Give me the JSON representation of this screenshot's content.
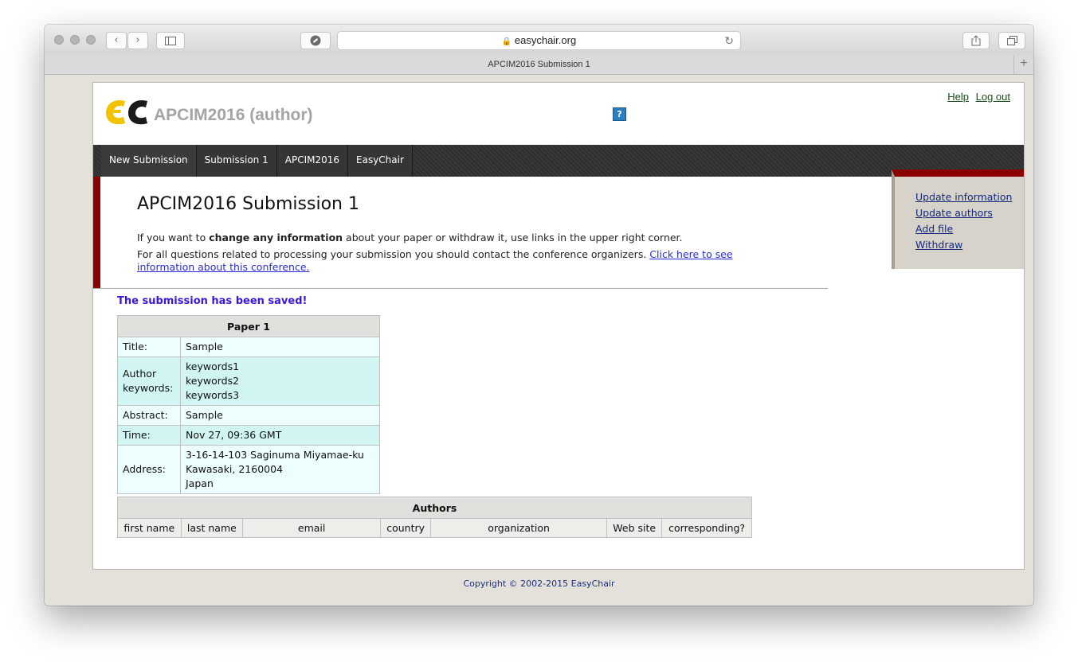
{
  "browser": {
    "address": "easychair.org",
    "tab_title": "APCIM2016 Submission 1",
    "back_glyph": "‹",
    "forward_glyph": "›",
    "newtab_glyph": "+"
  },
  "header": {
    "site_title": "APCIM2016 (author)",
    "help_icon_text": "?",
    "help_link": "Help",
    "logout_link": "Log out"
  },
  "nav": {
    "items": [
      "New Submission",
      "Submission 1",
      "APCIM2016",
      "EasyChair"
    ]
  },
  "main": {
    "heading": "APCIM2016 Submission 1",
    "info1_pre": "If you want to ",
    "info1_bold": "change any information",
    "info1_post": " about your paper or withdraw it, use links in the upper right corner.",
    "info2_text": "For all questions related to processing your submission you should contact the conference organizers. ",
    "info2_link": "Click here to see information about this conference.",
    "saved_message": "The submission has been saved!"
  },
  "sidebar": {
    "links": [
      "Update information",
      "Update authors",
      "Add file",
      "Withdraw"
    ]
  },
  "paper": {
    "header": "Paper 1",
    "rows": [
      {
        "label": "Title:",
        "value": "Sample"
      },
      {
        "label": "Author keywords:",
        "values": [
          "keywords1",
          "keywords2",
          "keywords3"
        ]
      },
      {
        "label": "Abstract:",
        "value": "Sample"
      },
      {
        "label": "Time:",
        "value": "Nov 27, 09:36 GMT"
      },
      {
        "label": "Address:",
        "values": [
          "3-16-14-103 Saginuma Miyamae-ku",
          "Kawasaki, 2160004",
          "Japan"
        ]
      }
    ]
  },
  "authors": {
    "header": "Authors",
    "columns": [
      "first name",
      "last name",
      "email",
      "country",
      "organization",
      "Web site",
      "corresponding?"
    ]
  },
  "footer": {
    "copyright": "Copyright © 2002-2015 EasyChair"
  },
  "colors": {
    "brand_red": "#8b0000",
    "link_blue": "#2b2bdd",
    "saved_purple": "#3a17d8",
    "row_light": "#edfefe",
    "row_dark": "#d0f5f3"
  }
}
